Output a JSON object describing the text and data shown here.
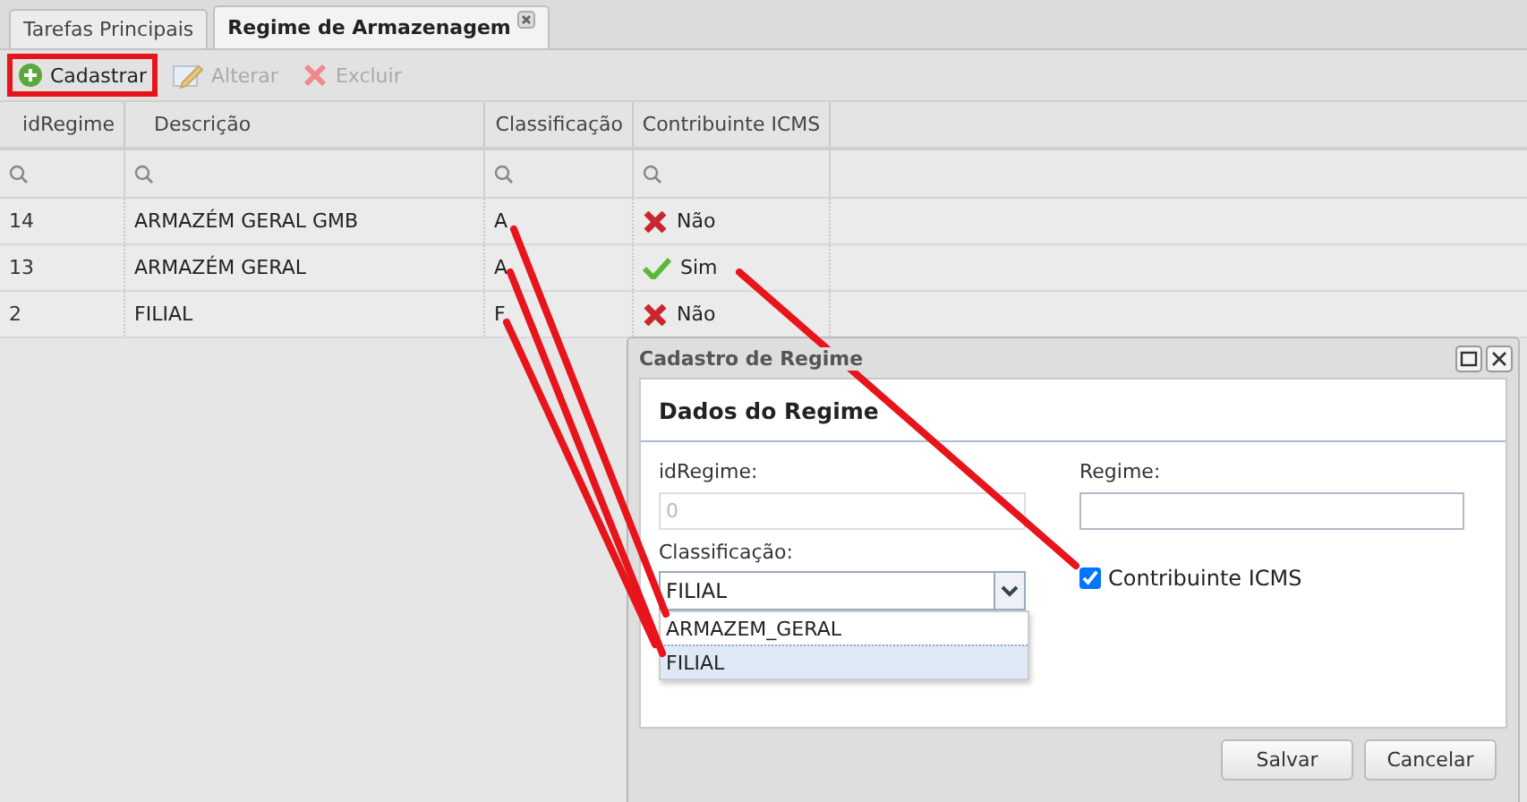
{
  "tabs": [
    {
      "label": "Tarefas Principais",
      "selected": false,
      "closable": false
    },
    {
      "label": "Regime de Armazenagem",
      "selected": true,
      "closable": true
    }
  ],
  "toolbar": [
    {
      "label": "Cadastrar",
      "kind": "add",
      "disabled": false,
      "highlighted": true
    },
    {
      "label": "Alterar",
      "kind": "edit",
      "disabled": true,
      "highlighted": false
    },
    {
      "label": "Excluir",
      "kind": "delete",
      "disabled": true,
      "highlighted": false
    }
  ],
  "table": {
    "columns": [
      "idRegime",
      "Descrição",
      "Classificação",
      "Contribuinte ICMS"
    ],
    "rows": [
      {
        "id": "14",
        "descricao": "ARMAZÉM GERAL GMB",
        "classificacao": "A",
        "icms": {
          "checked": false,
          "label": "Não"
        }
      },
      {
        "id": "13",
        "descricao": "ARMAZÉM GERAL",
        "classificacao": "A",
        "icms": {
          "checked": true,
          "label": "Sim"
        }
      },
      {
        "id": "2",
        "descricao": "FILIAL",
        "classificacao": "F",
        "icms": {
          "checked": false,
          "label": "Não"
        }
      }
    ]
  },
  "dialog": {
    "title": "Cadastro de Regime",
    "section": "Dados do Regime",
    "id_label": "idRegime:",
    "id_placeholder": "0",
    "regime_label": "Regime:",
    "class_label": "Classificação:",
    "class_value": "FILIAL",
    "options": [
      {
        "label": "ARMAZEM_GERAL",
        "selected": false
      },
      {
        "label": "FILIAL",
        "selected": true
      }
    ],
    "icms_label": "Contribuinte ICMS",
    "icms_checked": true,
    "buttons": [
      "Salvar",
      "Cancelar"
    ]
  }
}
